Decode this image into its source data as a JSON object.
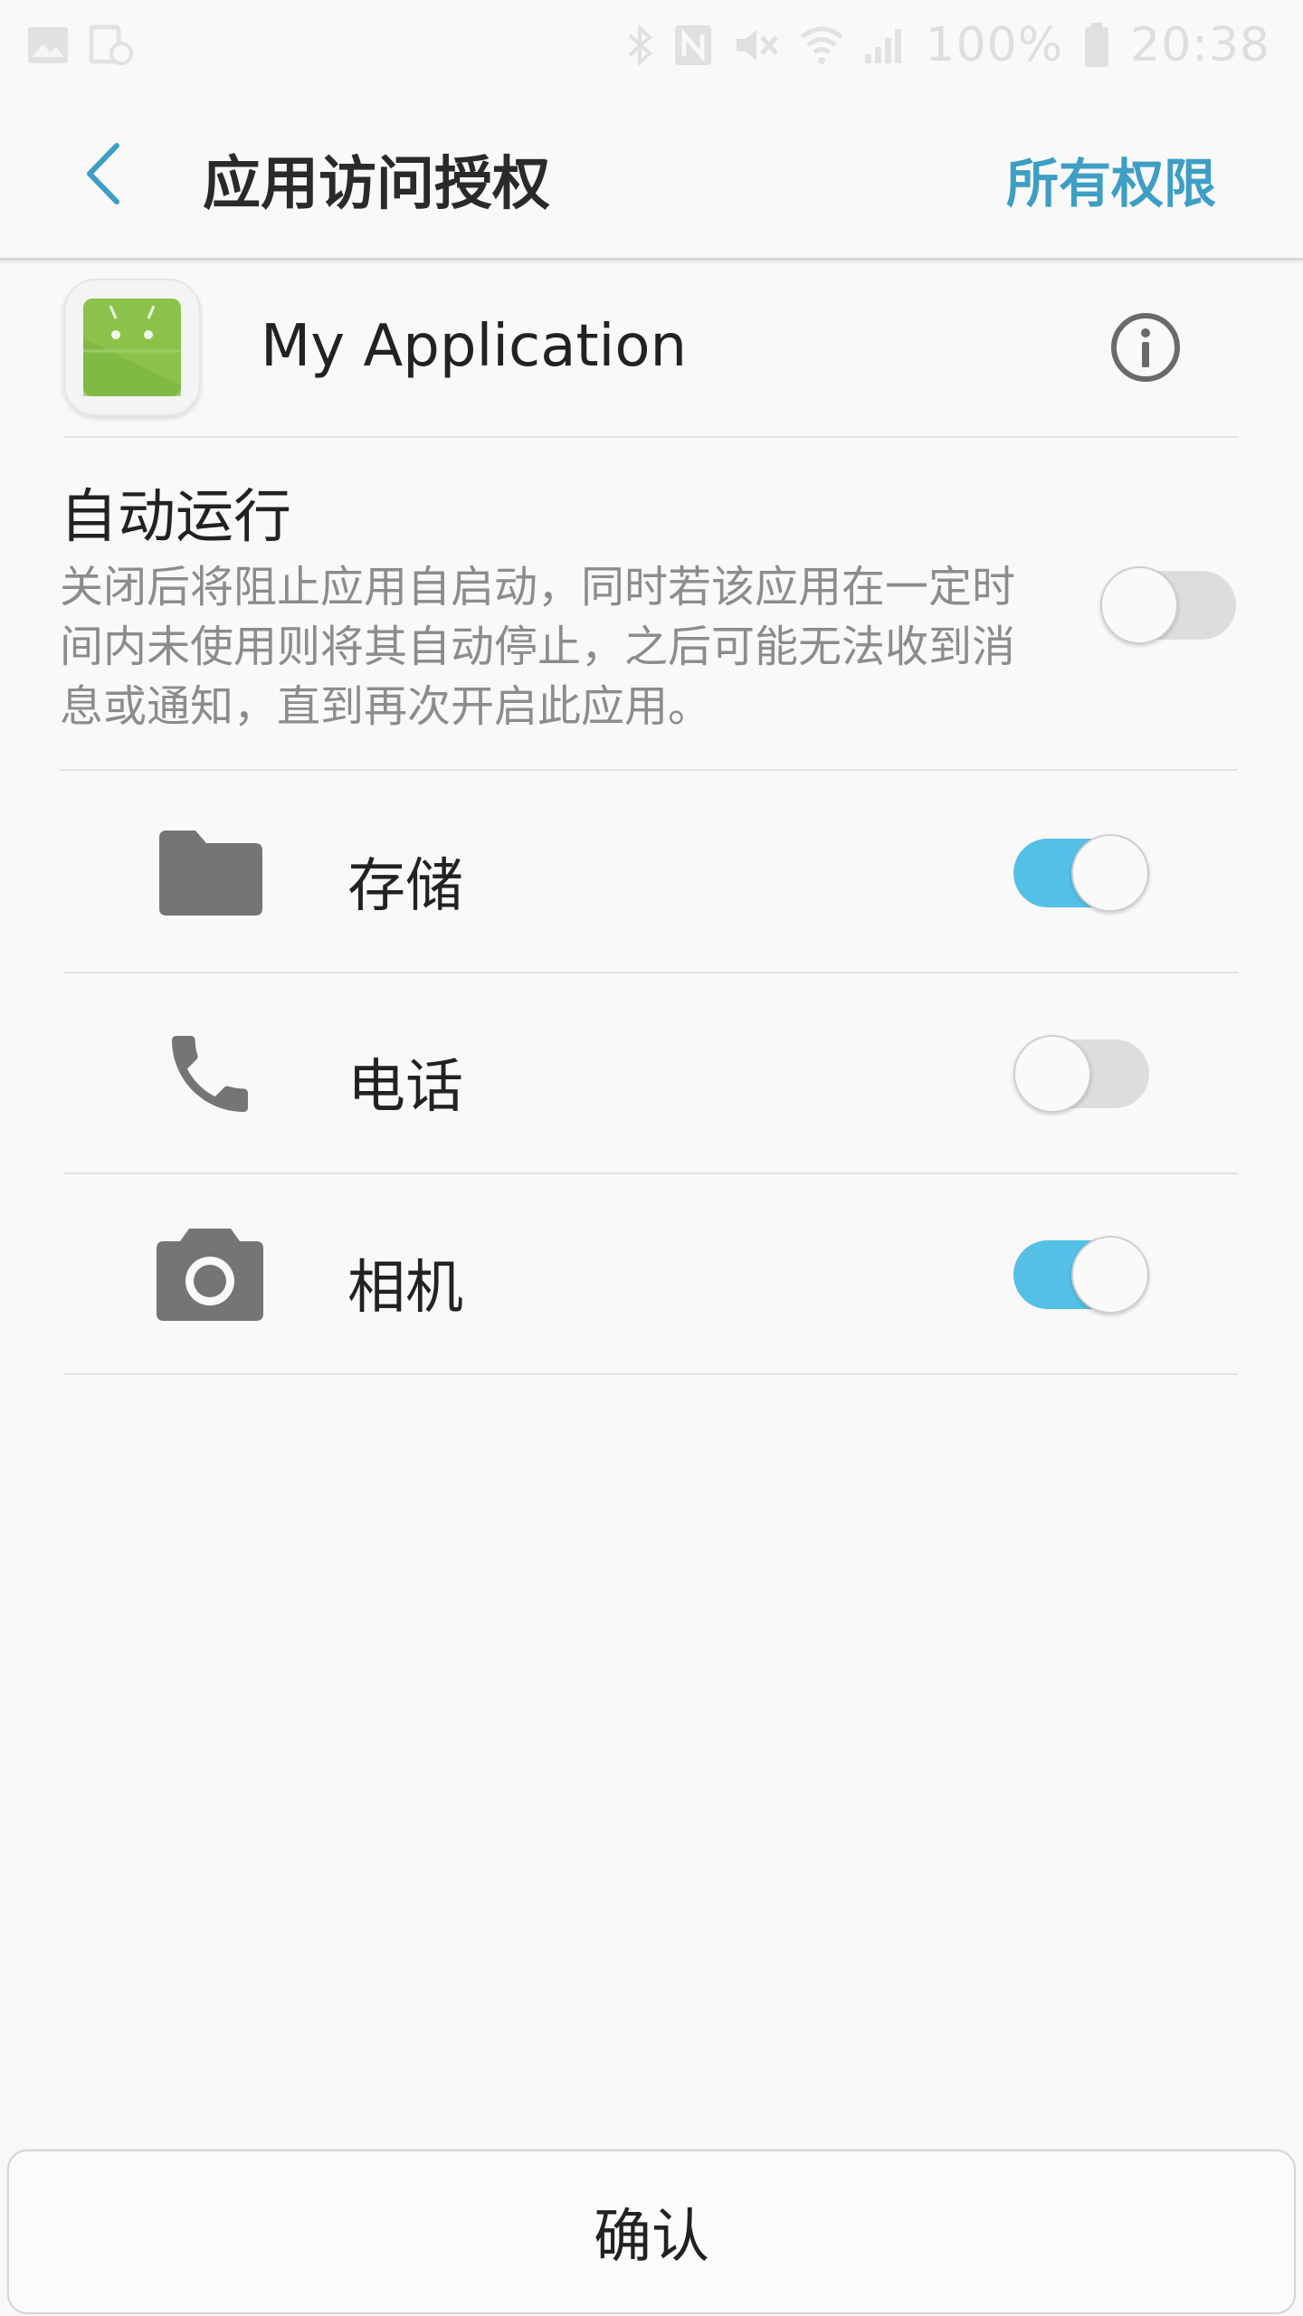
{
  "status_bar": {
    "battery": "100%",
    "time": "20:38",
    "icons": [
      "gallery-icon",
      "sync-icon",
      "bluetooth-icon",
      "nfc-icon",
      "mute-icon",
      "wifi-icon",
      "signal-icon",
      "battery-icon"
    ]
  },
  "app_bar": {
    "back_icon": "back-chevron-icon",
    "title": "应用访问授权",
    "action": "所有权限"
  },
  "app": {
    "name": "My Application",
    "icon": "android-icon",
    "info_icon": "info-icon"
  },
  "autostart": {
    "title": "自动运行",
    "description": "关闭后将阻止应用自启动，同时若该应用在一定时间内未使用则将其自动停止，之后可能无法收到消息或通知，直到再次开启此应用。",
    "enabled": false
  },
  "permissions": [
    {
      "label": "存储",
      "icon": "folder-icon",
      "enabled": true
    },
    {
      "label": "电话",
      "icon": "phone-icon",
      "enabled": false
    },
    {
      "label": "相机",
      "icon": "camera-icon",
      "enabled": true
    }
  ],
  "confirm": {
    "label": "确认"
  },
  "colors": {
    "accent": "#55c0e6",
    "action_text": "#3e9ec4",
    "icon_gray": "#757575",
    "android_green": "#8bc34a"
  }
}
